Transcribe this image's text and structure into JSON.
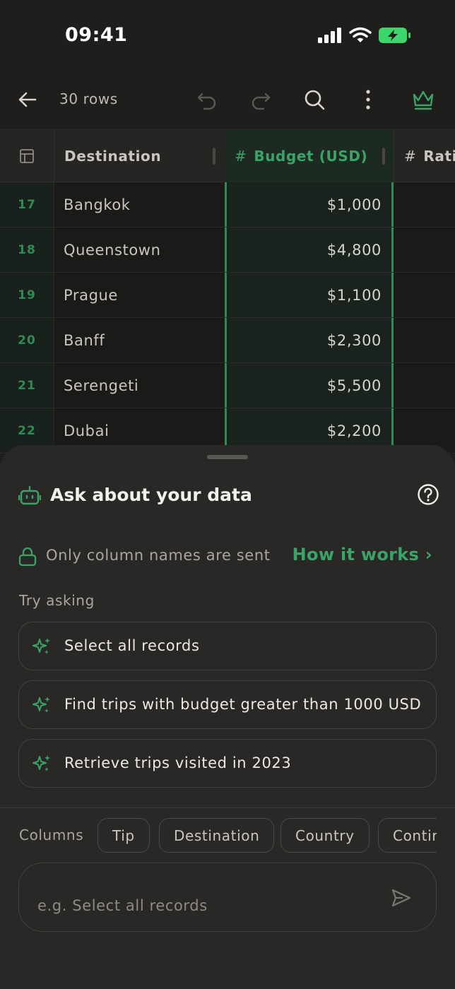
{
  "status": {
    "time": "09:41"
  },
  "toolbar": {
    "rows_label": "30 rows"
  },
  "grid": {
    "columns": [
      {
        "name": "Destination"
      },
      {
        "name": "Budget (USD)"
      },
      {
        "name": "Ratin"
      }
    ],
    "rows": [
      {
        "num": "17",
        "destination": "Bangkok",
        "budget": "$1,000"
      },
      {
        "num": "18",
        "destination": "Queenstown",
        "budget": "$4,800"
      },
      {
        "num": "19",
        "destination": "Prague",
        "budget": "$1,100"
      },
      {
        "num": "20",
        "destination": "Banff",
        "budget": "$2,300"
      },
      {
        "num": "21",
        "destination": "Serengeti",
        "budget": "$5,500"
      },
      {
        "num": "22",
        "destination": "Dubai",
        "budget": "$2,200"
      }
    ]
  },
  "sheet": {
    "title": "Ask about your data",
    "privacy_text": "Only column names are sent",
    "how_link": "How it works ›",
    "try_label": "Try asking",
    "suggestions": [
      "Select all records",
      "Find trips with budget greater than 1000 USD",
      "Retrieve trips visited in 2023"
    ],
    "columns_label": "Columns",
    "column_chips": [
      "Tip",
      "Destination",
      "Country",
      "Contir"
    ],
    "input_placeholder": "e.g. Select all records"
  },
  "colors": {
    "accent": "#3aa466",
    "background": "#1f1e1c",
    "sheet": "#2a2826"
  }
}
